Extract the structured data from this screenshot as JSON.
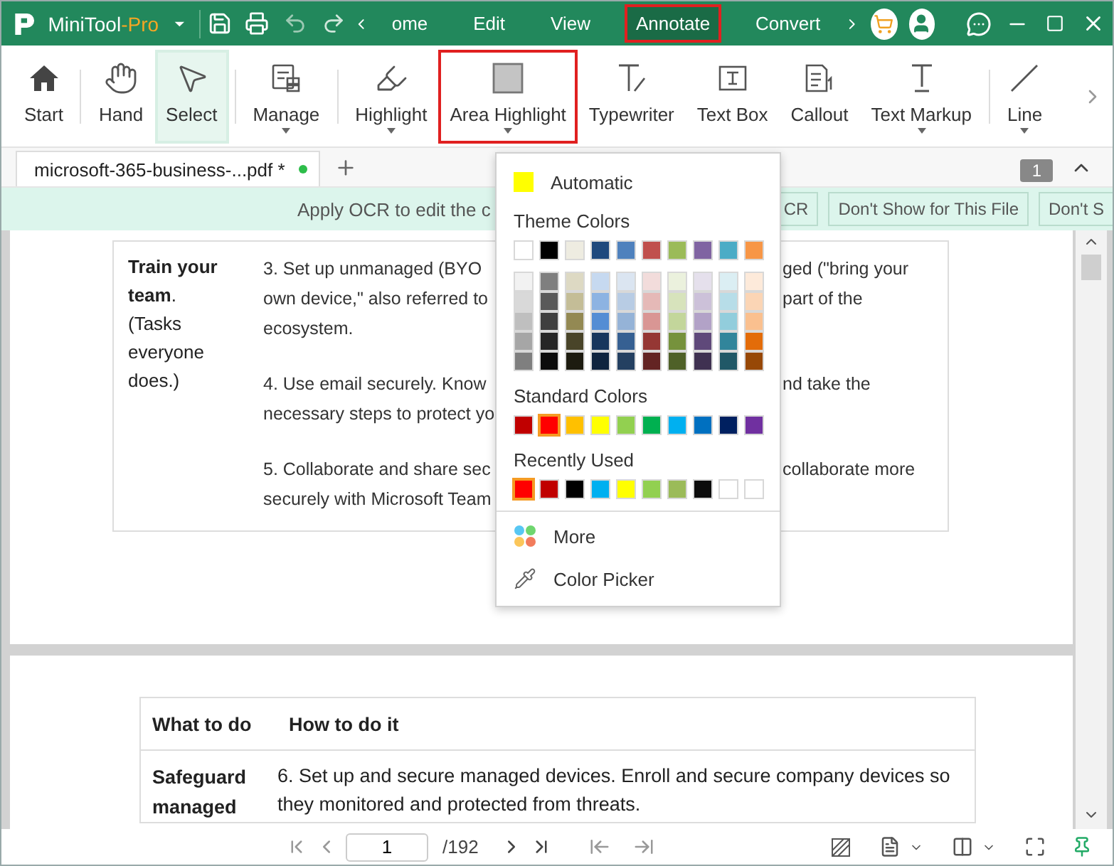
{
  "title_bar": {
    "app_name": "MiniTool",
    "edition": "-Pro"
  },
  "menu_tabs": [
    {
      "label": "ome",
      "selected": false,
      "outlined": false
    },
    {
      "label": "Edit",
      "selected": false,
      "outlined": false
    },
    {
      "label": "View",
      "selected": false,
      "outlined": false
    },
    {
      "label": "Annotate",
      "selected": true,
      "outlined": true
    },
    {
      "label": "Convert",
      "selected": false,
      "outlined": false
    }
  ],
  "toolbar": [
    {
      "label": "Start",
      "selected": false,
      "dropdown": false,
      "outlined": false
    },
    {
      "label": "Hand",
      "selected": false,
      "dropdown": false,
      "outlined": false
    },
    {
      "label": "Select",
      "selected": true,
      "dropdown": false,
      "outlined": false
    },
    {
      "label": "Manage",
      "selected": false,
      "dropdown": true,
      "outlined": false
    },
    {
      "label": "Highlight",
      "selected": false,
      "dropdown": true,
      "outlined": false
    },
    {
      "label": "Area Highlight",
      "selected": false,
      "dropdown": true,
      "outlined": true
    },
    {
      "label": "Typewriter",
      "selected": false,
      "dropdown": false,
      "outlined": false
    },
    {
      "label": "Text Box",
      "selected": false,
      "dropdown": false,
      "outlined": false
    },
    {
      "label": "Callout",
      "selected": false,
      "dropdown": false,
      "outlined": false
    },
    {
      "label": "Text Markup",
      "selected": false,
      "dropdown": true,
      "outlined": false
    },
    {
      "label": "Line",
      "selected": false,
      "dropdown": true,
      "outlined": false
    }
  ],
  "tabs": [
    {
      "label": "microsoft-365-business-...pdf *",
      "selected": true,
      "modified": true
    }
  ],
  "page_badge": "1",
  "ocr_banner": {
    "message": "Apply OCR to edit the c",
    "buttons": [
      "CR",
      "Don't Show for This File",
      "Don't S"
    ]
  },
  "color_menu": {
    "automatic": {
      "label": "Automatic",
      "color": "#ffff00"
    },
    "theme_title": "Theme Colors",
    "theme_top": [
      {
        "color": "#ffffff",
        "selected": false
      },
      {
        "color": "#000000",
        "selected": false
      },
      {
        "color": "#eeece1",
        "selected": false
      },
      {
        "color": "#1f497d",
        "selected": false
      },
      {
        "color": "#4f81bd",
        "selected": false
      },
      {
        "color": "#c0504d",
        "selected": false
      },
      {
        "color": "#9bbb59",
        "selected": false
      },
      {
        "color": "#8064a2",
        "selected": false
      },
      {
        "color": "#4bacc6",
        "selected": false
      },
      {
        "color": "#f79646",
        "selected": false
      }
    ],
    "theme_shades": [
      [
        {
          "color": "#f2f2f2",
          "selected": false
        },
        {
          "color": "#7f7f7f",
          "selected": false
        },
        {
          "color": "#ddd9c3",
          "selected": false
        },
        {
          "color": "#c6d9f0",
          "selected": false
        },
        {
          "color": "#dbe5f1",
          "selected": false
        },
        {
          "color": "#f2dcdb",
          "selected": false
        },
        {
          "color": "#ebf1dd",
          "selected": false
        },
        {
          "color": "#e5e0ec",
          "selected": false
        },
        {
          "color": "#dbeef3",
          "selected": false
        },
        {
          "color": "#fdeada",
          "selected": false
        }
      ],
      [
        {
          "color": "#d9d9d9",
          "selected": false
        },
        {
          "color": "#595959",
          "selected": false
        },
        {
          "color": "#c4bd97",
          "selected": false
        },
        {
          "color": "#8db3e2",
          "selected": false
        },
        {
          "color": "#b8cce4",
          "selected": false
        },
        {
          "color": "#e5b9b7",
          "selected": false
        },
        {
          "color": "#d7e3bc",
          "selected": false
        },
        {
          "color": "#ccc1d9",
          "selected": false
        },
        {
          "color": "#b7dde8",
          "selected": false
        },
        {
          "color": "#fbd5b5",
          "selected": false
        }
      ],
      [
        {
          "color": "#bfbfbf",
          "selected": false
        },
        {
          "color": "#3f3f3f",
          "selected": false
        },
        {
          "color": "#938953",
          "selected": false
        },
        {
          "color": "#548dd4",
          "selected": false
        },
        {
          "color": "#95b3d7",
          "selected": false
        },
        {
          "color": "#d99694",
          "selected": false
        },
        {
          "color": "#c3d69b",
          "selected": false
        },
        {
          "color": "#b2a2c7",
          "selected": false
        },
        {
          "color": "#92cddc",
          "selected": false
        },
        {
          "color": "#fac08f",
          "selected": false
        }
      ],
      [
        {
          "color": "#a6a6a6",
          "selected": false
        },
        {
          "color": "#262626",
          "selected": false
        },
        {
          "color": "#494429",
          "selected": false
        },
        {
          "color": "#17365d",
          "selected": false
        },
        {
          "color": "#366092",
          "selected": false
        },
        {
          "color": "#953734",
          "selected": false
        },
        {
          "color": "#76923c",
          "selected": false
        },
        {
          "color": "#5f497a",
          "selected": false
        },
        {
          "color": "#31859b",
          "selected": false
        },
        {
          "color": "#e36c09",
          "selected": false
        }
      ],
      [
        {
          "color": "#7f7f7f",
          "selected": false
        },
        {
          "color": "#0c0c0c",
          "selected": false
        },
        {
          "color": "#1d1b10",
          "selected": false
        },
        {
          "color": "#0f243e",
          "selected": false
        },
        {
          "color": "#244061",
          "selected": false
        },
        {
          "color": "#632423",
          "selected": false
        },
        {
          "color": "#4f6128",
          "selected": false
        },
        {
          "color": "#3f3151",
          "selected": false
        },
        {
          "color": "#205867",
          "selected": false
        },
        {
          "color": "#974806",
          "selected": false
        }
      ]
    ],
    "standard_title": "Standard Colors",
    "standard": [
      {
        "color": "#c00000",
        "selected": false
      },
      {
        "color": "#ff0000",
        "selected": true
      },
      {
        "color": "#ffc000",
        "selected": false
      },
      {
        "color": "#ffff00",
        "selected": false
      },
      {
        "color": "#92d050",
        "selected": false
      },
      {
        "color": "#00b050",
        "selected": false
      },
      {
        "color": "#00b0f0",
        "selected": false
      },
      {
        "color": "#0070c0",
        "selected": false
      },
      {
        "color": "#002060",
        "selected": false
      },
      {
        "color": "#7030a0",
        "selected": false
      }
    ],
    "recent_title": "Recently Used",
    "recent": [
      {
        "color": "#ff0000",
        "selected": true
      },
      {
        "color": "#c00000",
        "selected": false
      },
      {
        "color": "#000000",
        "selected": false
      },
      {
        "color": "#00b0f0",
        "selected": false
      },
      {
        "color": "#ffff00",
        "selected": false
      },
      {
        "color": "#92d050",
        "selected": false
      },
      {
        "color": "#9bbb59",
        "selected": false
      },
      {
        "color": "#0c0c0c",
        "selected": false
      },
      {
        "color": "#ffffff",
        "selected": false
      },
      {
        "color": "#ffffff",
        "selected": false
      }
    ],
    "actions": [
      {
        "label": "More",
        "kind": "more"
      },
      {
        "label": "Color Picker",
        "kind": "picker"
      }
    ]
  },
  "document": {
    "page_1": {
      "label": "**Train your team**.",
      "note": "(Tasks everyone does.)",
      "paragraphs": [
        [
          {
            "left": "3. Set up unmanaged (BYO",
            "right": "ged (\"bring your"
          },
          {
            "left": "own device,\" also referred to",
            "right": "part of the"
          },
          {
            "left": "ecosystem."
          }
        ],
        [
          {
            "left": "4. Use email securely. Know",
            "right": "nd take the"
          },
          {
            "left": "necessary steps to protect yo"
          }
        ],
        [
          {
            "left": "5. Collaborate and share sec",
            "right": "collaborate more"
          },
          {
            "left": "securely with Microsoft Team"
          }
        ]
      ]
    },
    "page_2": {
      "headers": [
        "What to do",
        "How to do it"
      ],
      "label": "Safeguard managed",
      "lines": [
        "6. Set up and secure managed devices. Enroll and secure company devices so",
        "they monitored and protected from threats."
      ]
    }
  },
  "pager": {
    "page": "1",
    "total": "/192"
  }
}
